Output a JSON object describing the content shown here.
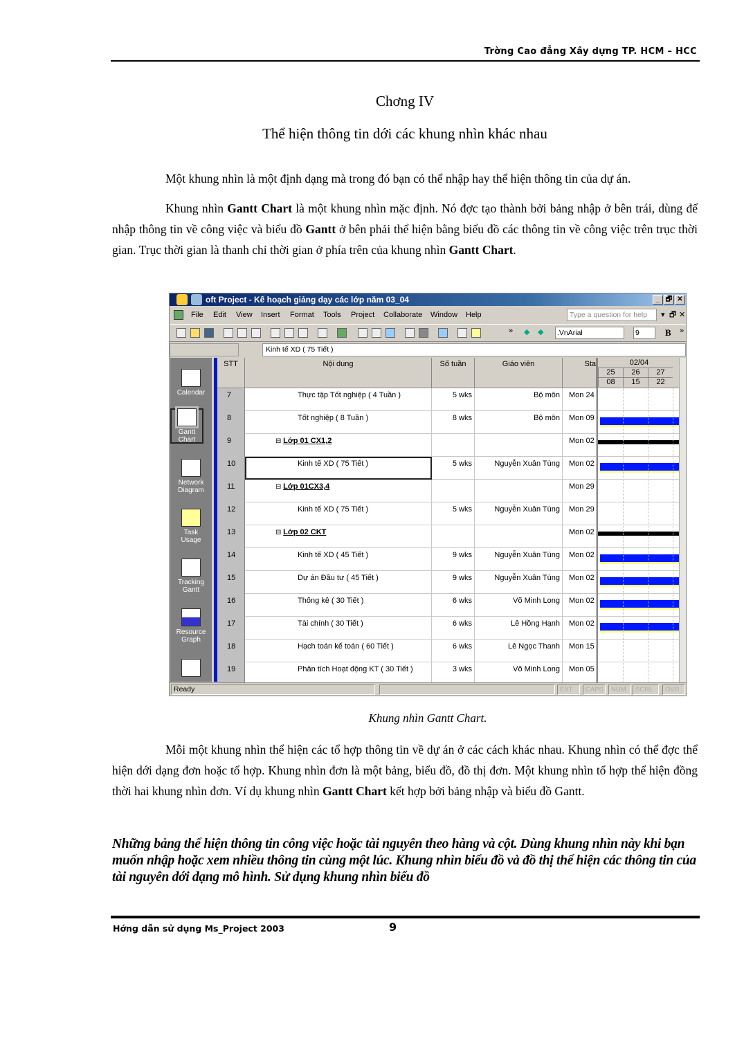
{
  "header": {
    "school": "Trờng   Cao đẳng Xây dựng TP. HCM – HCC"
  },
  "chapter": {
    "title": "Chơng   IV",
    "subtitle": "Thể hiện thông tin dới   các khung nhìn khác nhau"
  },
  "paragraphs": [
    "Một khung nhìn là một định dạng mà trong đó bạn có thể nhập hay thể hiện thông tin của dự án.",
    {
      "a": "Khung nhìn ",
      "b1": "Gantt Chart",
      "c": " là một khung nhìn mặc định. Nó đợc   tạo thành bởi bảng nhập ở bên trái, dùng để nhập thông tin về công việc và biểu đồ ",
      "b2": "Gantt",
      "d": " ở bên phải thể hiện bằng biểu đồ các thông tin về công việc trên trục thời gian. Trục thời gian là thanh chỉ thời gian ở phía trên của khung nhìn ",
      "b3": "Gantt Chart",
      "e": "."
    },
    {
      "a": "Mỗi một khung nhìn thể hiện các tổ hợp thông tin về dự án ở các cách  khác nhau. Khung nhìn có thể đợc   thể hiện dới   dạng đơn hoặc tổ hợp. Khung nhìn đơn là một bảng, biểu đồ, đồ thị đơn. Một khung nhìn tổ hợp thể hiện đồng thời hai khung nhìn đơn. Ví dụ khung nhìn ",
      "b": "Gantt Chart",
      "c": " kết hợp bởi bảng nhập và biểu đồ Gantt."
    }
  ],
  "italic_paragraph": "Những bảng thể hiện thông tin công việc hoặc tài nguyên theo hàng và cột. Dùng khung nhìn này khi bạn muốn nhập hoặc xem nhiều thông tin cùng một lúc. Khung nhìn biểu đồ và đồ thị thể hiện các thông tin của tài nguyên dới   dạng mô hình. Sử dụng khung nhìn biểu đồ",
  "caption": "Khung nhìn Gantt Chart.",
  "footer": {
    "text": "Hớng   dẫn sử dụng Ms_Project 2003",
    "page": "9"
  },
  "app": {
    "title": "oft Project - Kế hoạch giảng dạy các lớp năm 03_04",
    "window_buttons": [
      "_",
      "🗗",
      "✕"
    ],
    "menu": [
      "File",
      "Edit",
      "View",
      "Insert",
      "Format",
      "Tools",
      "Project",
      "Collaborate",
      "Window",
      "Help"
    ],
    "help_placeholder": "Type a question for help",
    "font": ".VnArial",
    "font_size": "9",
    "bold_label": "B",
    "entry_value": "Kinh tế XD ( 75 Tiết )",
    "views": [
      "Calendar",
      "Gantt Chart",
      "Network Diagram",
      "Task Usage",
      "Tracking Gantt",
      "Resource Graph"
    ],
    "columns": [
      "STT",
      "Nội dung",
      "Số tuần",
      "Giáo viên",
      "Sta"
    ],
    "timescale": {
      "top": "02/04",
      "days": [
        "25",
        "26",
        "27"
      ],
      "weeks": [
        "08",
        "15",
        "22"
      ]
    },
    "rows": [
      {
        "id": "7",
        "name": "Thực tập Tốt nghiệp ( 4 Tuần )",
        "dur": "5 wks",
        "teacher": "Bộ môn",
        "start": "Mon 24",
        "type": "task",
        "bar": "none"
      },
      {
        "id": "8",
        "name": "Tốt nghiệp ( 8 Tuần )",
        "dur": "8 wks",
        "teacher": "Bộ môn",
        "start": "Mon 09",
        "type": "task",
        "bar": "task"
      },
      {
        "id": "9",
        "name": "Lớp 01 CX1,2",
        "dur": "",
        "teacher": "",
        "start": "Mon 02",
        "type": "summary",
        "bar": "summary"
      },
      {
        "id": "10",
        "name": "Kinh tế XD ( 75 Tiết )",
        "dur": "5 wks",
        "teacher": "Nguyễn Xuân Tùng",
        "start": "Mon 02",
        "type": "task",
        "bar": "task",
        "selected": true
      },
      {
        "id": "11",
        "name": "Lớp 01CX3,4",
        "dur": "",
        "teacher": "",
        "start": "Mon 29",
        "type": "summary",
        "bar": "none"
      },
      {
        "id": "12",
        "name": "Kinh tế XD ( 75 Tiết )",
        "dur": "5 wks",
        "teacher": "Nguyễn Xuân Tùng",
        "start": "Mon 29",
        "type": "task",
        "bar": "none"
      },
      {
        "id": "13",
        "name": "Lớp 02 CKT",
        "dur": "",
        "teacher": "",
        "start": "Mon 02",
        "type": "summary",
        "bar": "summary"
      },
      {
        "id": "14",
        "name": "Kinh tế XD ( 45 Tiết )",
        "dur": "9 wks",
        "teacher": "Nguyễn Xuân Tùng",
        "start": "Mon 02",
        "type": "task",
        "bar": "task"
      },
      {
        "id": "15",
        "name": "Dự án Đầu tư ( 45 Tiết )",
        "dur": "9 wks",
        "teacher": "Nguyễn Xuân Tùng",
        "start": "Mon 02",
        "type": "task",
        "bar": "task"
      },
      {
        "id": "16",
        "name": "Thống kê ( 30 Tiết )",
        "dur": "6 wks",
        "teacher": "Võ Minh Long",
        "start": "Mon 02",
        "type": "task",
        "bar": "task"
      },
      {
        "id": "17",
        "name": "Tài chính ( 30 Tiết )",
        "dur": "6 wks",
        "teacher": "Lê Hồng Hạnh",
        "start": "Mon 02",
        "type": "task",
        "bar": "task"
      },
      {
        "id": "18",
        "name": "Hạch toán kế toán ( 60 Tiết )",
        "dur": "6 wks",
        "teacher": "Lê Ngọc Thanh",
        "start": "Mon 15",
        "type": "task",
        "bar": "none"
      },
      {
        "id": "19",
        "name": "Phân tích Hoạt động KT ( 30 Tiết )",
        "dur": "3 wks",
        "teacher": "Võ Minh Long",
        "start": "Mon 05",
        "type": "task",
        "bar": "none"
      }
    ],
    "status": {
      "ready": "Ready",
      "indicators": [
        "EXT",
        "CAPS",
        "NUM",
        "SCRL",
        "OVR"
      ]
    },
    "colors": {
      "titlebar": "#0a246a",
      "bar": "#0018ff",
      "chrome": "#d4d0c8"
    }
  }
}
